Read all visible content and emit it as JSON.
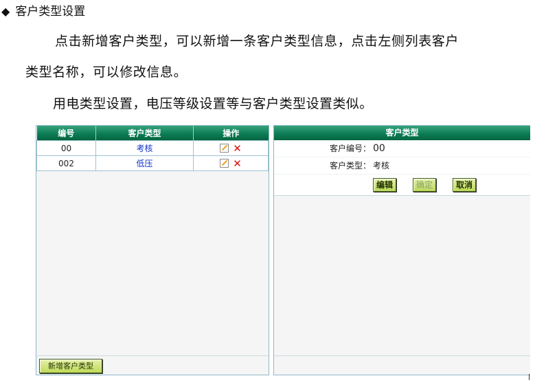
{
  "doc": {
    "heading_bullet": "◆",
    "heading": "客户类型设置",
    "para1": "点击新增客户类型，可以新增一条客户类型信息，点击左侧列表客户",
    "para2": "类型名称，可以修改信息。",
    "para3": "用电类型设置，电压等级设置等与客户类型设置类似。"
  },
  "list": {
    "columns": [
      "编号",
      "客户类型",
      "操作"
    ],
    "rows": [
      {
        "code": "00",
        "type": "考核"
      },
      {
        "code": "002",
        "type": "低压"
      }
    ],
    "edit_glyph": "",
    "delete_glyph": "✕",
    "add_button": "新增客户类型"
  },
  "detail": {
    "title": "客户类型",
    "code_label": "客户编号：",
    "code_value": "00",
    "type_label": "客户类型：",
    "type_value": "考核",
    "edit_button": "编辑",
    "confirm_button": "确定",
    "cancel_button": "取消"
  },
  "colors": {
    "header_green": "#0a7a54",
    "button_green": "#c0db5a",
    "link_blue": "#1133cc",
    "delete_red": "#d01010"
  }
}
